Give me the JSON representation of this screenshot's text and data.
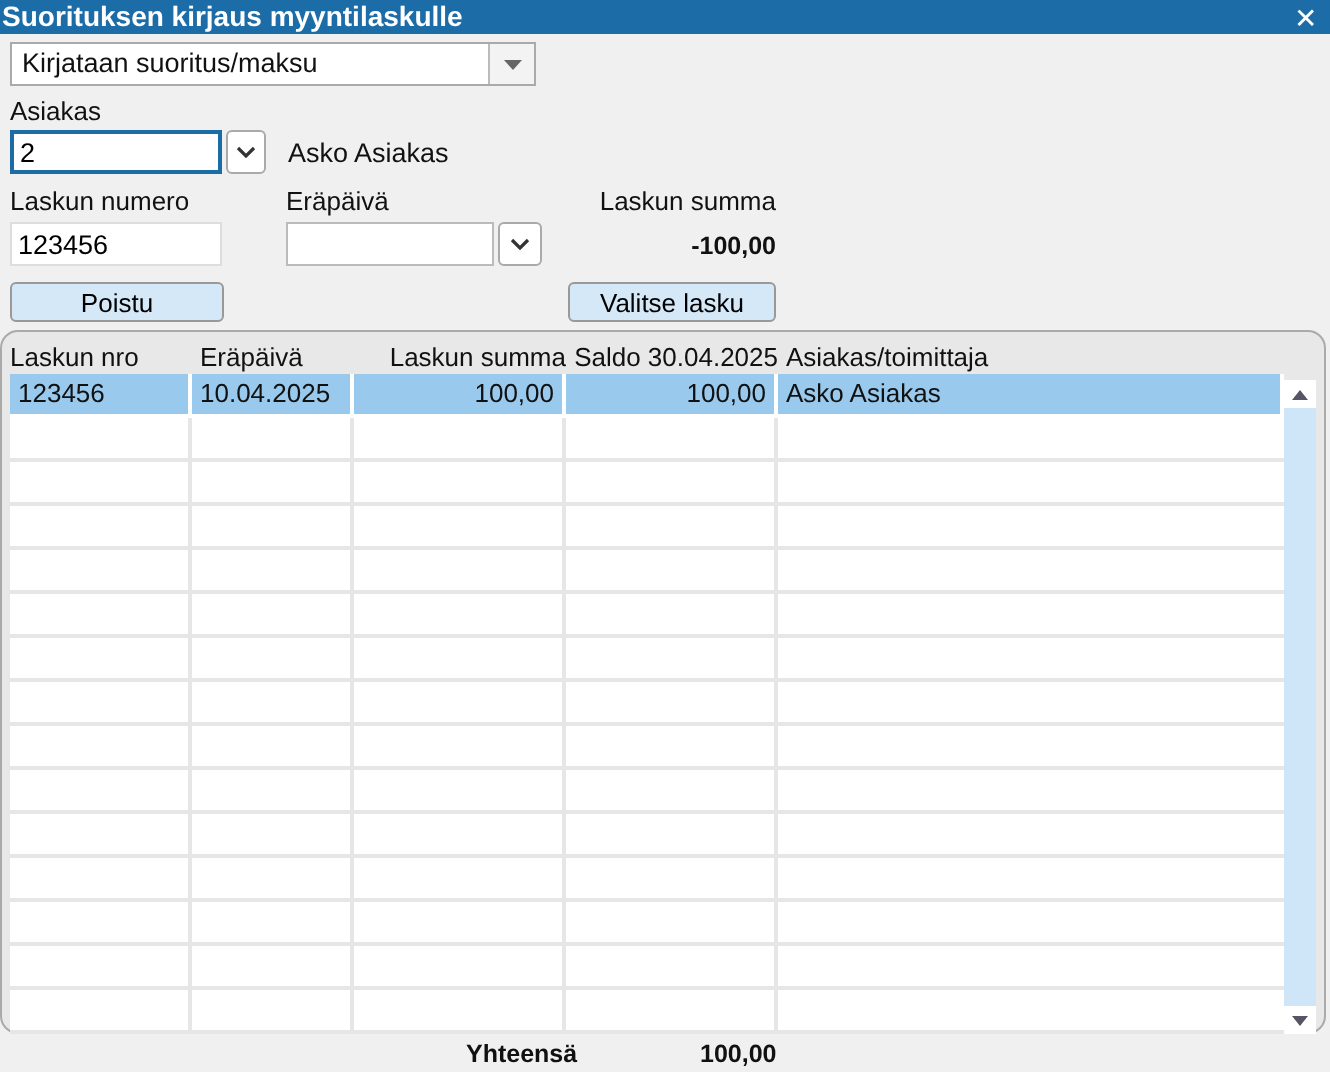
{
  "window": {
    "title": "Suorituksen kirjaus myyntilaskulle",
    "close": "✕"
  },
  "mode_dropdown": {
    "value": "Kirjataan suoritus/maksu"
  },
  "customer": {
    "label": "Asiakas",
    "value": "2",
    "name": "Asko Asiakas"
  },
  "invoice_number": {
    "label": "Laskun numero",
    "value": "123456"
  },
  "due_date": {
    "label": "Eräpäivä"
  },
  "invoice_sum": {
    "label": "Laskun summa",
    "value": "-100,00"
  },
  "buttons": [
    {
      "label": "Poistu"
    },
    {
      "label": "Valitse lasku"
    }
  ],
  "table": {
    "columns": [
      "Laskun nro",
      "Eräpäivä",
      "Laskun summa",
      "Saldo 30.04.2025",
      "Asiakas/toimittaja"
    ],
    "rows": [
      {
        "cells": [
          "123456",
          "10.04.2025",
          "100,00",
          "100,00",
          "Asko Asiakas"
        ],
        "selected": true
      }
    ]
  },
  "total": {
    "label": "Yhteensä",
    "value": "100,00"
  }
}
